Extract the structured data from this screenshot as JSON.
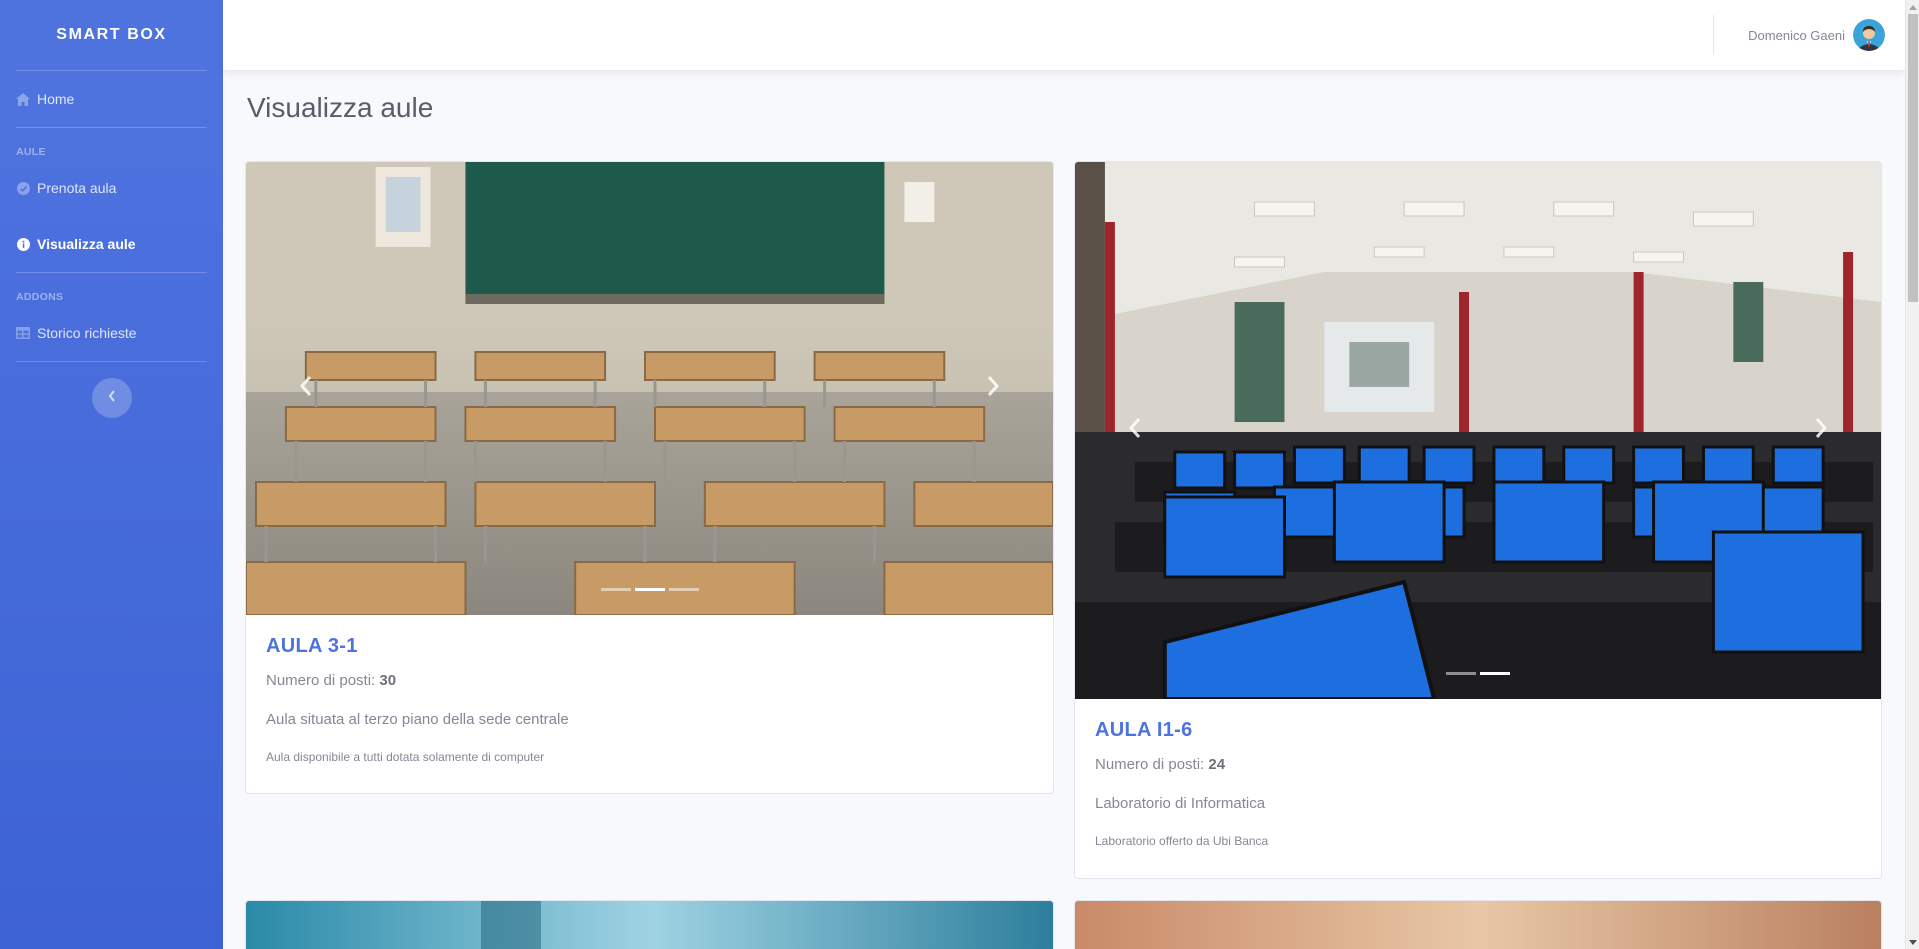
{
  "brand": "SMART BOX",
  "sidebar": {
    "home": "Home",
    "heading_aule": "AULE",
    "prenota": "Prenota aula",
    "visualizza": "Visualizza aule",
    "heading_addons": "ADDONS",
    "storico": "Storico richieste"
  },
  "user": {
    "name": "Domenico Gaeni"
  },
  "page": {
    "title": "Visualizza aule"
  },
  "rooms": [
    {
      "title": "AULA 3-1",
      "seats_label": "Numero di posti: ",
      "seats": "30",
      "description": "Aula situata al terzo piano della sede centrale",
      "note": "Aula disponibile a tutti dotata solamente di computer",
      "slides": 3,
      "active_slide": 2
    },
    {
      "title": "AULA I1-6",
      "seats_label": "Numero di posti: ",
      "seats": "24",
      "description": "Laboratorio di Informatica",
      "note": "Laboratorio offerto da Ubi Banca",
      "slides": 2,
      "active_slide": 2
    }
  ],
  "colors": {
    "primary": "#4e73df",
    "text_muted": "#858796",
    "background": "#f8f9fc"
  },
  "icons": {
    "home": "home-icon",
    "prenota": "check-circle-icon",
    "visualizza": "info-circle-icon",
    "storico": "table-icon",
    "toggle": "chevron-left-icon"
  }
}
